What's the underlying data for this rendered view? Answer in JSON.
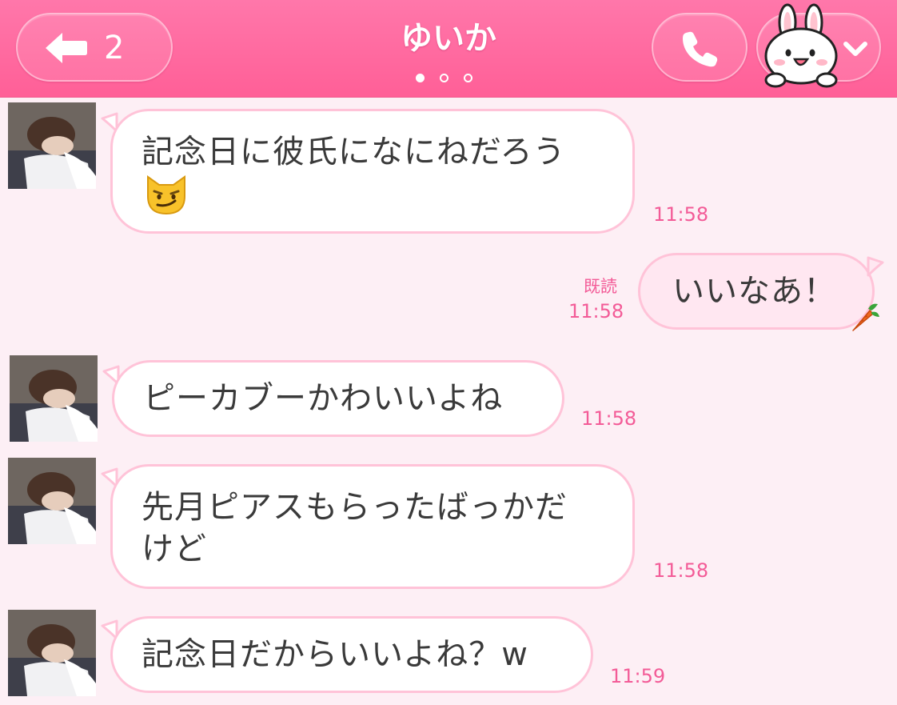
{
  "header": {
    "back_count": "2",
    "title": "ゆいか",
    "page_dots": 3,
    "active_dot": 0,
    "icons": {
      "back": "back-arrow-icon",
      "call": "phone-icon",
      "menu": "chevron-down-icon",
      "sticker": "bunny-character-icon"
    }
  },
  "messages": [
    {
      "sender": "ゆいか",
      "line1": "記念日に彼氏になにねだろう",
      "emoji": "smirking-cat-emoji",
      "time": "11:58"
    },
    {
      "sender": "me",
      "text": "いいなあ！",
      "emoji": "carrot-emoji",
      "read": "既読",
      "time": "11:58"
    },
    {
      "sender": "ゆいか",
      "text": "ピーカブーかわいいよね",
      "time": "11:58"
    },
    {
      "sender": "ゆいか",
      "line1": "先月ピアスもらったばっかだ",
      "line2": "けど",
      "time": "11:58"
    },
    {
      "sender": "ゆいか",
      "text": "記念日だからいいよね？w",
      "time": "11:59"
    }
  ],
  "colors": {
    "header": "#ff6aa0",
    "background": "#fdeff5",
    "bubble_border": "#ffc3d8",
    "my_bubble": "#ffe7f1",
    "time_text": "#f35b97"
  }
}
